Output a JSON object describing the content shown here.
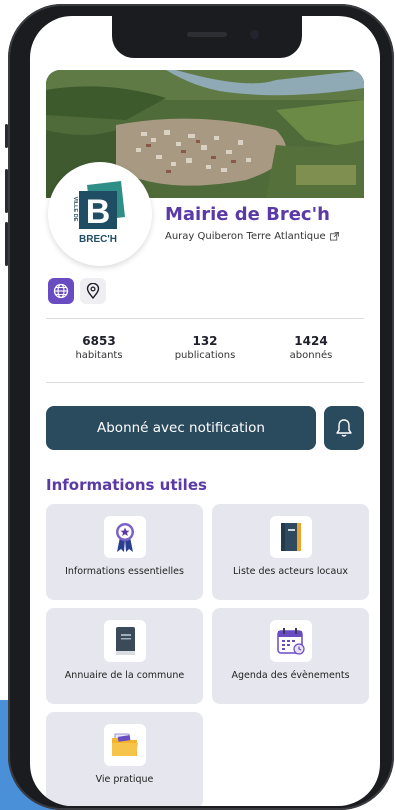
{
  "profile": {
    "title": "Mairie de Brec'h",
    "subtitle": "Auray Quiberon Terre Atlantique",
    "logo_text_vertical": "VILLE DE",
    "logo_letter": "B",
    "logo_name": "BREC'H"
  },
  "chips": [
    {
      "icon": "globe-icon"
    },
    {
      "icon": "map-pin-icon"
    }
  ],
  "stats": [
    {
      "value": "6853",
      "label": "habitants"
    },
    {
      "value": "132",
      "label": "publications"
    },
    {
      "value": "1424",
      "label": "abonnés"
    }
  ],
  "subscribe": {
    "label": "Abonné avec notification",
    "bell_icon": "bell-icon"
  },
  "section": {
    "title": "Informations utiles"
  },
  "cards": [
    {
      "label": "Informations essentielles",
      "icon": "award-ribbon-icon"
    },
    {
      "label": "Liste des acteurs locaux",
      "icon": "notebook-icon"
    },
    {
      "label": "Annuaire de la commune",
      "icon": "book-icon"
    },
    {
      "label": "Agenda des évènements",
      "icon": "calendar-icon"
    },
    {
      "label": "Vie pratique",
      "icon": "folder-icon"
    }
  ],
  "colors": {
    "accent": "#5b3aa8",
    "button": "#2a4a5e",
    "card_bg": "#e6e7ee",
    "logo_blue": "#1f4d63",
    "logo_teal": "#2f8f86"
  }
}
